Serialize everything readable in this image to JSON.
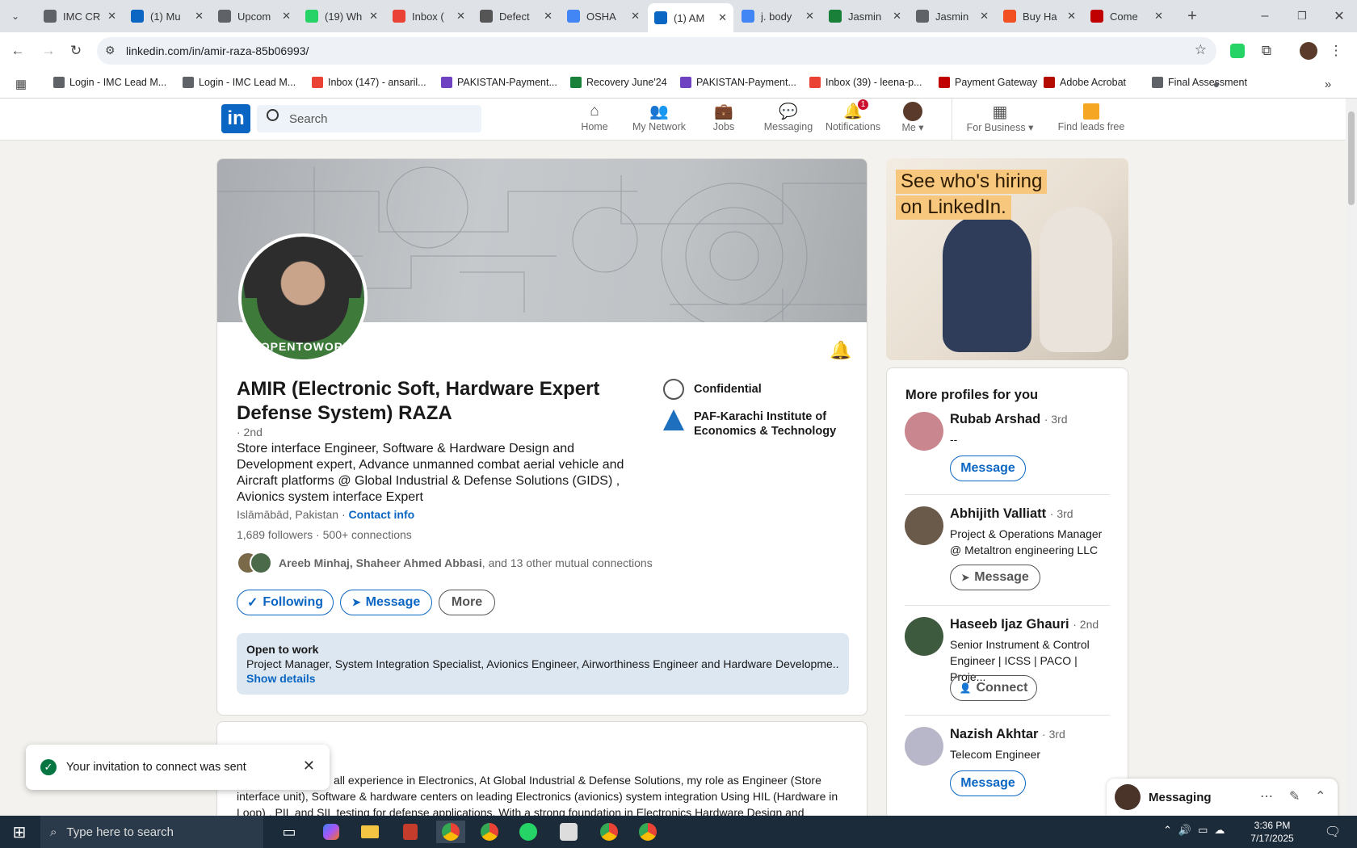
{
  "browser": {
    "tabs": [
      {
        "label": "IMC CR",
        "color": "#5f6368"
      },
      {
        "label": "(1) Mu",
        "color": "#0a66c2"
      },
      {
        "label": "Upcom",
        "color": "#5f6368"
      },
      {
        "label": "(19) Wh",
        "color": "#25d366"
      },
      {
        "label": "Inbox (",
        "color": "#ea4335"
      },
      {
        "label": "Defect",
        "color": "#555555"
      },
      {
        "label": "OSHA",
        "color": "#4285f4"
      },
      {
        "label": "(1) AM",
        "color": "#0a66c2"
      },
      {
        "label": "j. body",
        "color": "#4285f4"
      },
      {
        "label": "Jasmin",
        "color": "#188038"
      },
      {
        "label": "Jasmin",
        "color": "#5f6368"
      },
      {
        "label": "Buy Ha",
        "color": "#f25022"
      },
      {
        "label": "Come",
        "color": "#c00000"
      }
    ],
    "active_tab_index": 7,
    "url": "linkedin.com/in/amir-raza-85b06993/",
    "bookmarks": [
      {
        "label": "Login - IMC Lead M...",
        "color": "#5f6368"
      },
      {
        "label": "Login - IMC Lead M...",
        "color": "#5f6368"
      },
      {
        "label": "Inbox (147) - ansaril...",
        "color": "#ea4335"
      },
      {
        "label": "PAKISTAN-Payment...",
        "color": "#6f42c1"
      },
      {
        "label": "Recovery June'24",
        "color": "#188038"
      },
      {
        "label": "PAKISTAN-Payment...",
        "color": "#6f42c1"
      },
      {
        "label": "Inbox (39) - leena-p...",
        "color": "#ea4335"
      },
      {
        "label": "Payment Gateway",
        "color": "#c00000"
      },
      {
        "label": "Adobe Acrobat",
        "color": "#b30b00"
      },
      {
        "label": "Final Assessment",
        "color": "#5f6368"
      }
    ]
  },
  "linkedin": {
    "search_placeholder": "Search",
    "nav": [
      {
        "label": "Home",
        "badge": "",
        "icon": "home-icon"
      },
      {
        "label": "My Network",
        "badge": "",
        "icon": "network-icon"
      },
      {
        "label": "Jobs",
        "badge": "",
        "icon": "jobs-icon"
      },
      {
        "label": "Messaging",
        "badge": "",
        "icon": "messaging-icon"
      },
      {
        "label": "Notifications",
        "badge": "1",
        "icon": "bell-icon"
      },
      {
        "label": "Me",
        "badge": "",
        "icon": "avatar"
      }
    ],
    "business_label": "For Business",
    "leads_label": "Find leads free"
  },
  "profile": {
    "name": "AMIR (Electronic Soft, Hardware Expert Defense System) RAZA",
    "degree": "· 2nd",
    "headline": "Store interface Engineer, Software & Hardware Design and Development expert, Advance unmanned combat aerial vehicle and Aircraft platforms @ Global Industrial & Defense Solutions (GIDS) , Avionics system interface Expert",
    "location": "Islāmābād, Pakistan",
    "contact_info": "Contact info",
    "followers": "1,689 followers",
    "connections": "500+ connections",
    "mutual_names": "Areeb Minhaj, Shaheer Ahmed Abbasi",
    "mutual_rest": ", and 13 other mutual connections",
    "opentowork_badge": "#OPENTOWORK",
    "company": "Confidential",
    "school": "PAF-Karachi Institute of Economics & Technology",
    "buttons": {
      "following": "Following",
      "message": "Message",
      "more": "More"
    },
    "open_to_work": {
      "title": "Open to work",
      "roles": "Project Manager, System Integration Specialist, Avionics Engineer, Airworthiness Engineer and Hardware Developme...",
      "show_details": "Show details"
    },
    "about_text_1": "all experience in Electronics, At Global Industrial & Defense Solutions, my role as Engineer (Store",
    "about_text_2": "interface unit), Software & hardware centers on leading Electronics (avionics) system integration Using HIL (Hardware in",
    "about_text_3": "Loop) , PIL and SIL testing for defense applications. With a strong foundation in Electronics Hardware Design and"
  },
  "ad": {
    "line1": "See who's hiring",
    "line2": "on LinkedIn."
  },
  "sidebar": {
    "title": "More profiles for you",
    "profiles": [
      {
        "name": "Rubab Arshad",
        "degree": "· 3rd",
        "desc": "--",
        "button": "Message"
      },
      {
        "name": "Abhijith Valliatt",
        "degree": "· 3rd",
        "desc": "Project & Operations Manager @ Metaltron engineering LLC",
        "button": "Message"
      },
      {
        "name": "Haseeb Ijaz Ghauri",
        "degree": "· 2nd",
        "desc": "Senior Instrument & Control Engineer | ICSS | PACO | Proje...",
        "button": "Connect"
      },
      {
        "name": "Nazish Akhtar",
        "degree": "· 3rd",
        "desc": "Telecom Engineer",
        "button": "Message"
      }
    ]
  },
  "toast": {
    "text": "Your invitation to connect was sent"
  },
  "messaging": {
    "label": "Messaging"
  },
  "taskbar": {
    "search_placeholder": "Type here to search",
    "time": "3:36 PM",
    "date": "7/17/2025"
  }
}
